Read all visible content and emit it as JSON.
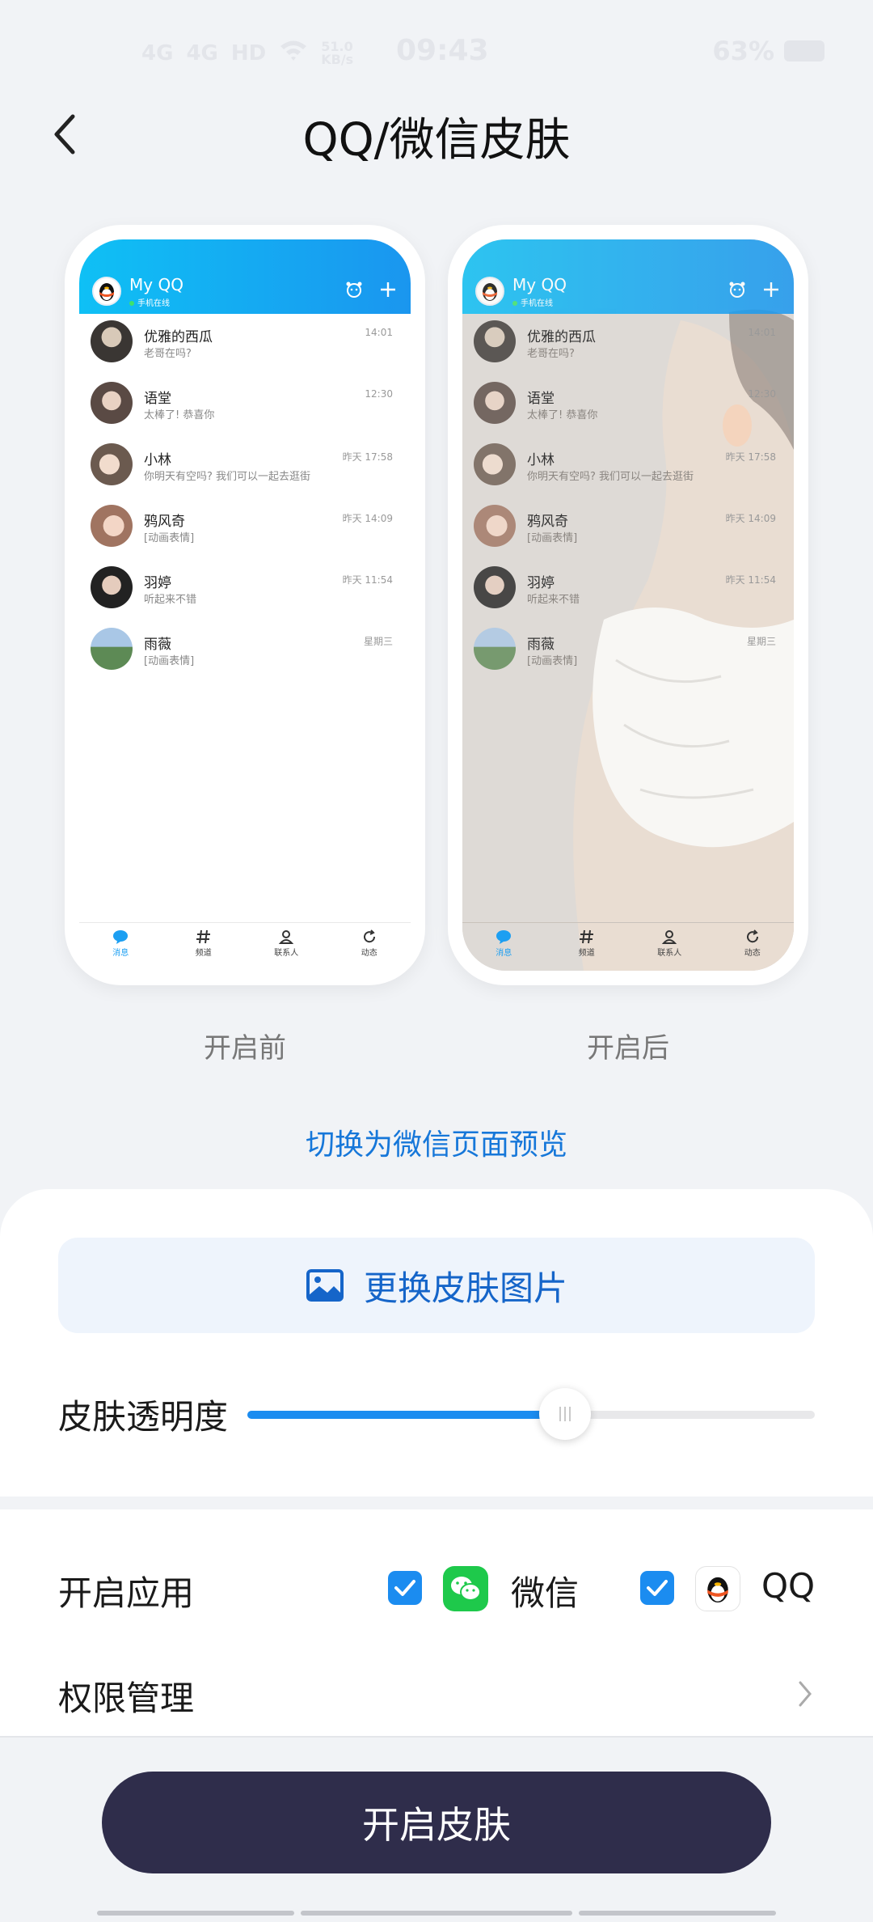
{
  "status_bar": {
    "network1": "4G",
    "network2": "4G",
    "hd": "HD",
    "speed": "51.0 KB/s",
    "time": "09:43",
    "battery": "63%"
  },
  "header": {
    "title": "QQ/微信皮肤"
  },
  "preview": {
    "qq_app_name": "My QQ",
    "qq_status": "手机在线",
    "chats": [
      {
        "name": "优雅的西瓜",
        "message": "老哥在吗?",
        "time": "14:01"
      },
      {
        "name": "语堂",
        "message": "太棒了! 恭喜你",
        "time": "12:30"
      },
      {
        "name": "小林",
        "message": "你明天有空吗? 我们可以一起去逛街",
        "time": "昨天 17:58"
      },
      {
        "name": "鸦风奇",
        "message": "[动画表情]",
        "time": "昨天 14:09"
      },
      {
        "name": "羽婷",
        "message": "听起来不错",
        "time": "昨天 11:54"
      },
      {
        "name": "雨薇",
        "message": "[动画表情]",
        "time": "星期三"
      }
    ],
    "tabs": [
      "消息",
      "频道",
      "联系人",
      "动态"
    ],
    "caption_before": "开启前",
    "caption_after": "开启后"
  },
  "switch_link": "切换为微信页面预览",
  "change_skin_label": "更换皮肤图片",
  "opacity": {
    "label": "皮肤透明度",
    "value": 0.56
  },
  "apps": {
    "label": "开启应用",
    "wechat": "微信",
    "qq": "QQ",
    "wechat_checked": true,
    "qq_checked": true
  },
  "permissions_label": "权限管理",
  "start_button": "开启皮肤",
  "colors": {
    "accent": "#1b8cf0",
    "link": "#1677d9",
    "start_button": "#2f2d4b",
    "wechat_green": "#1ec94b"
  }
}
